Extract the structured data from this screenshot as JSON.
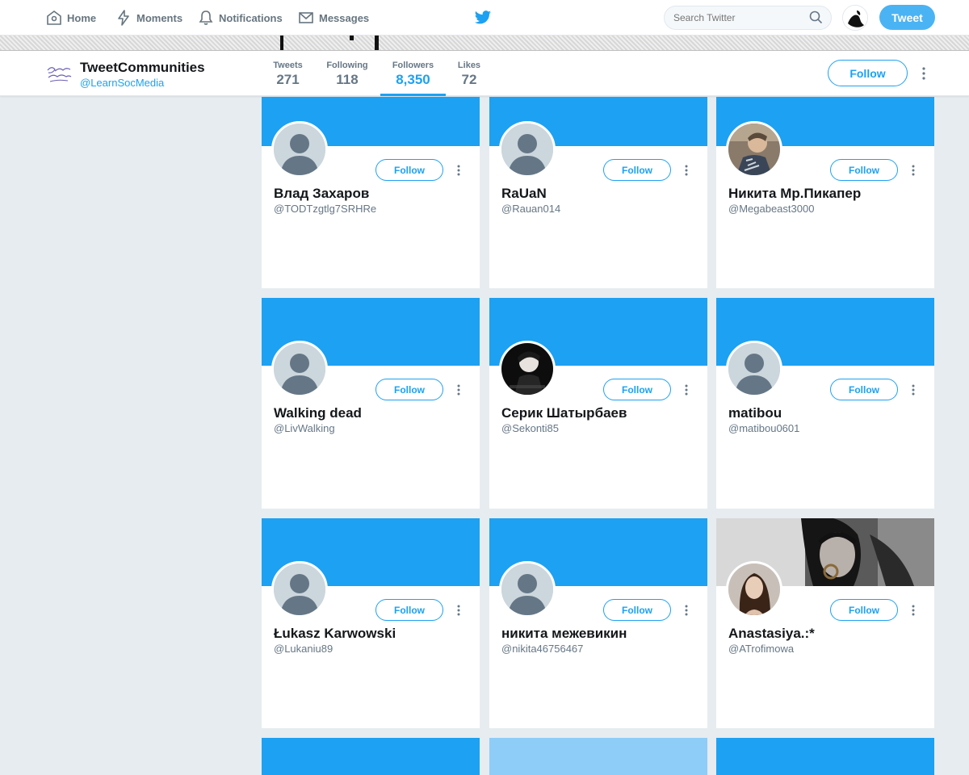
{
  "nav": {
    "home": "Home",
    "moments": "Moments",
    "notifications": "Notifications",
    "messages": "Messages",
    "search_placeholder": "Search Twitter",
    "tweet_button": "Tweet"
  },
  "profile": {
    "name": "TweetCommunities",
    "handle": "@LearnSocMedia",
    "stats": [
      {
        "label": "Tweets",
        "value": "271"
      },
      {
        "label": "Following",
        "value": "118"
      },
      {
        "label": "Followers",
        "value": "8,350"
      },
      {
        "label": "Likes",
        "value": "72"
      }
    ],
    "active_tab": "Followers",
    "follow_label": "Follow"
  },
  "cards": [
    {
      "name": "Влад Захаров",
      "handle": "@TODTzgtlg7SRHRe",
      "follow": "Follow",
      "avatar": "default-avatar-icon"
    },
    {
      "name": "RaUaN",
      "handle": "@Rauan014",
      "follow": "Follow",
      "avatar": "default-avatar-icon"
    },
    {
      "name": "Никита Мр.Пикапер",
      "handle": "@Megabeast3000",
      "follow": "Follow",
      "avatar": "photo"
    },
    {
      "name": "Walking dead",
      "handle": "@LivWalking",
      "follow": "Follow",
      "avatar": "default-avatar-icon"
    },
    {
      "name": "Серик Шатырбаев",
      "handle": "@Sekonti85",
      "follow": "Follow",
      "avatar": "photo"
    },
    {
      "name": "matibou",
      "handle": "@matibou0601",
      "follow": "Follow",
      "avatar": "default-avatar-icon"
    },
    {
      "name": "Łukasz Karwowski",
      "handle": "@Lukaniu89",
      "follow": "Follow",
      "avatar": "default-avatar-icon"
    },
    {
      "name": "никита межевикин",
      "handle": "@nikita46756467",
      "follow": "Follow",
      "avatar": "default-avatar-icon"
    },
    {
      "name": "Anastasiya.:*",
      "handle": "@ATrofimowa",
      "follow": "Follow",
      "avatar": "photo"
    }
  ],
  "colors": {
    "accent": "#1da1f2",
    "page_bg": "#e6ecf0",
    "muted_text": "#657786"
  }
}
